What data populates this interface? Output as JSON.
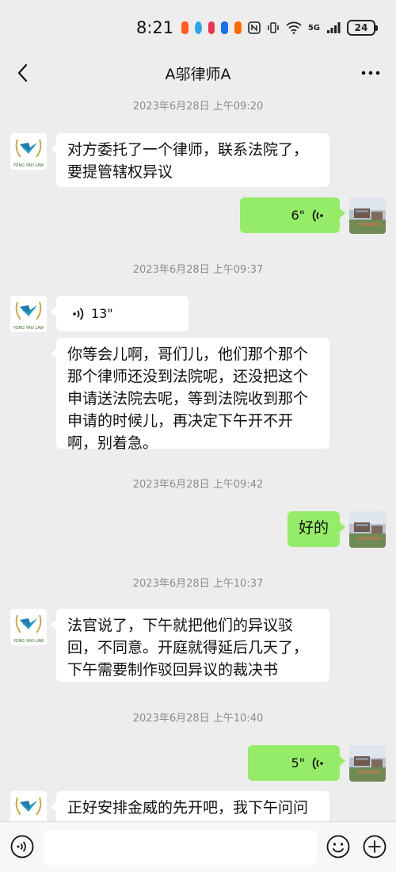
{
  "status_bar": {
    "time": "8:21",
    "network": "5G",
    "battery": "24",
    "app_icons": [
      "taobao-icon",
      "browser-icon",
      "store-icon",
      "tips-icon",
      "video-icon"
    ]
  },
  "header": {
    "title": "A邬律师A",
    "back_icon": "chevron-left-icon",
    "more_icon": "ellipsis-icon"
  },
  "messages": [
    {
      "type": "timestamp",
      "text": "2023年6月28日 上午09:20"
    },
    {
      "type": "text",
      "sender": "lawyer",
      "text": "对方委托了一个律师，联系法院了，要提管辖权异议"
    },
    {
      "type": "voice",
      "sender": "me",
      "duration": "6\""
    },
    {
      "type": "timestamp",
      "text": "2023年6月28日 上午09:37"
    },
    {
      "type": "voice",
      "sender": "lawyer",
      "duration": "13\""
    },
    {
      "type": "text",
      "sender": "lawyer",
      "text": "你等会儿啊，哥们儿，他们那个那个那个律师还没到法院呢，还没把这个申请送法院去呢，等到法院收到那个申请的时候儿，再决定下午开不开啊，别着急。"
    },
    {
      "type": "timestamp",
      "text": "2023年6月28日 上午09:42"
    },
    {
      "type": "text",
      "sender": "me",
      "text": "好的"
    },
    {
      "type": "timestamp",
      "text": "2023年6月28日 上午10:37"
    },
    {
      "type": "text",
      "sender": "lawyer",
      "text": "法官说了，下午就把他们的异议驳回，不同意。开庭就得延后几天了，下午需要制作驳回异议的裁决书"
    },
    {
      "type": "timestamp",
      "text": "2023年6月28日 上午10:40"
    },
    {
      "type": "voice",
      "sender": "me",
      "duration": "5\""
    },
    {
      "type": "text",
      "sender": "lawyer",
      "text": "正好安排金威的先开吧，我下午问问金"
    }
  ],
  "avatar_text": "YONG YAO LAW",
  "colors": {
    "background": "#ededed",
    "bubble_me": "#95ec69",
    "bubble_other": "#ffffff",
    "timestamp": "#8c8c8c"
  },
  "input_bar": {
    "voice_icon": "voice-toggle-icon",
    "emoji_icon": "smiley-icon",
    "plus_icon": "plus-circle-icon",
    "placeholder": ""
  }
}
